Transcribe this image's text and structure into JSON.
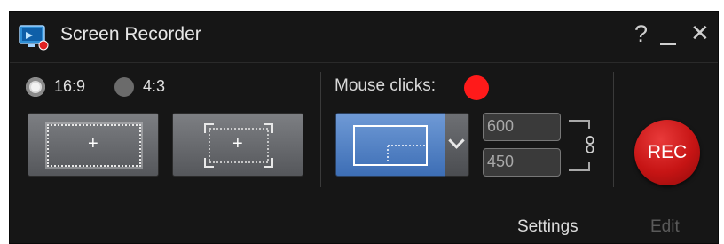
{
  "window": {
    "title": "Screen Recorder",
    "help_label": "?",
    "close_label": "✕"
  },
  "aspect": {
    "options": [
      {
        "label": "16:9",
        "selected": true
      },
      {
        "label": "4:3",
        "selected": false
      }
    ]
  },
  "capture": {
    "fixed_label": "+",
    "custom_label": "+",
    "mouse_clicks_label": "Mouse clicks:",
    "mouse_clicks_color": "#ff1a1a",
    "width": "600",
    "height": "450"
  },
  "rec": {
    "label": "REC",
    "color": "#c61414"
  },
  "footer": {
    "settings_label": "Settings",
    "edit_label": "Edit"
  },
  "icons": {
    "app": "screen-recorder-app-icon",
    "link": "chain-link-icon",
    "dropdown": "chevron-down-icon"
  }
}
